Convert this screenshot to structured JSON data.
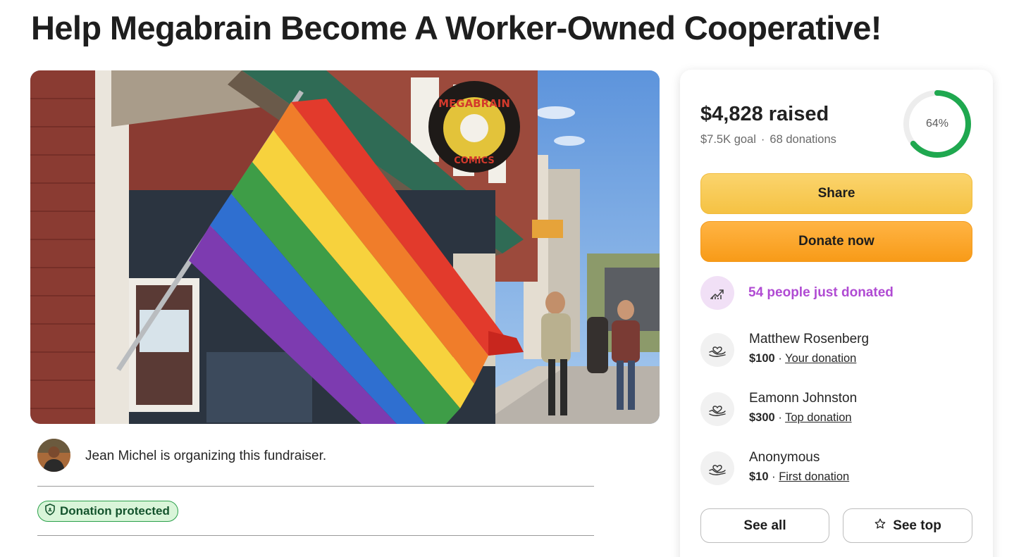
{
  "page": {
    "title": "Help Megabrain Become A Worker-Owned Cooperative!"
  },
  "hero": {
    "sign_top": "MEGABRAIN",
    "sign_bottom": "COMICS"
  },
  "organizer": {
    "text": "Jean Michel is organizing this fundraiser."
  },
  "badge": {
    "label": "Donation protected"
  },
  "fundraiser": {
    "raised": "$4,828 raised",
    "goal": "$7.5K goal",
    "separator": "·",
    "donations": "68 donations",
    "progress_percent": 64,
    "progress_label": "64%"
  },
  "buttons": {
    "share": "Share",
    "donate": "Donate now",
    "see_all": "See all",
    "see_top": "See top"
  },
  "trend": {
    "icon": "trending-up-icon",
    "text": "54 people just donated"
  },
  "donations": [
    {
      "name": "Matthew Rosenberg",
      "amount": "$100",
      "separator": "·",
      "tag": "Your donation"
    },
    {
      "name": "Eamonn Johnston",
      "amount": "$300",
      "separator": "·",
      "tag": "Top donation"
    },
    {
      "name": "Anonymous",
      "amount": "$10",
      "separator": "·",
      "tag": "First donation"
    }
  ],
  "colors": {
    "progress_ring": "#1fa84f",
    "ring_track": "#ededed",
    "share_button": "#f6c64c",
    "donate_button": "#f9a024",
    "trend_text": "#b04bd3",
    "badge_bg": "#d9f5d9",
    "badge_border": "#2aa04a"
  }
}
